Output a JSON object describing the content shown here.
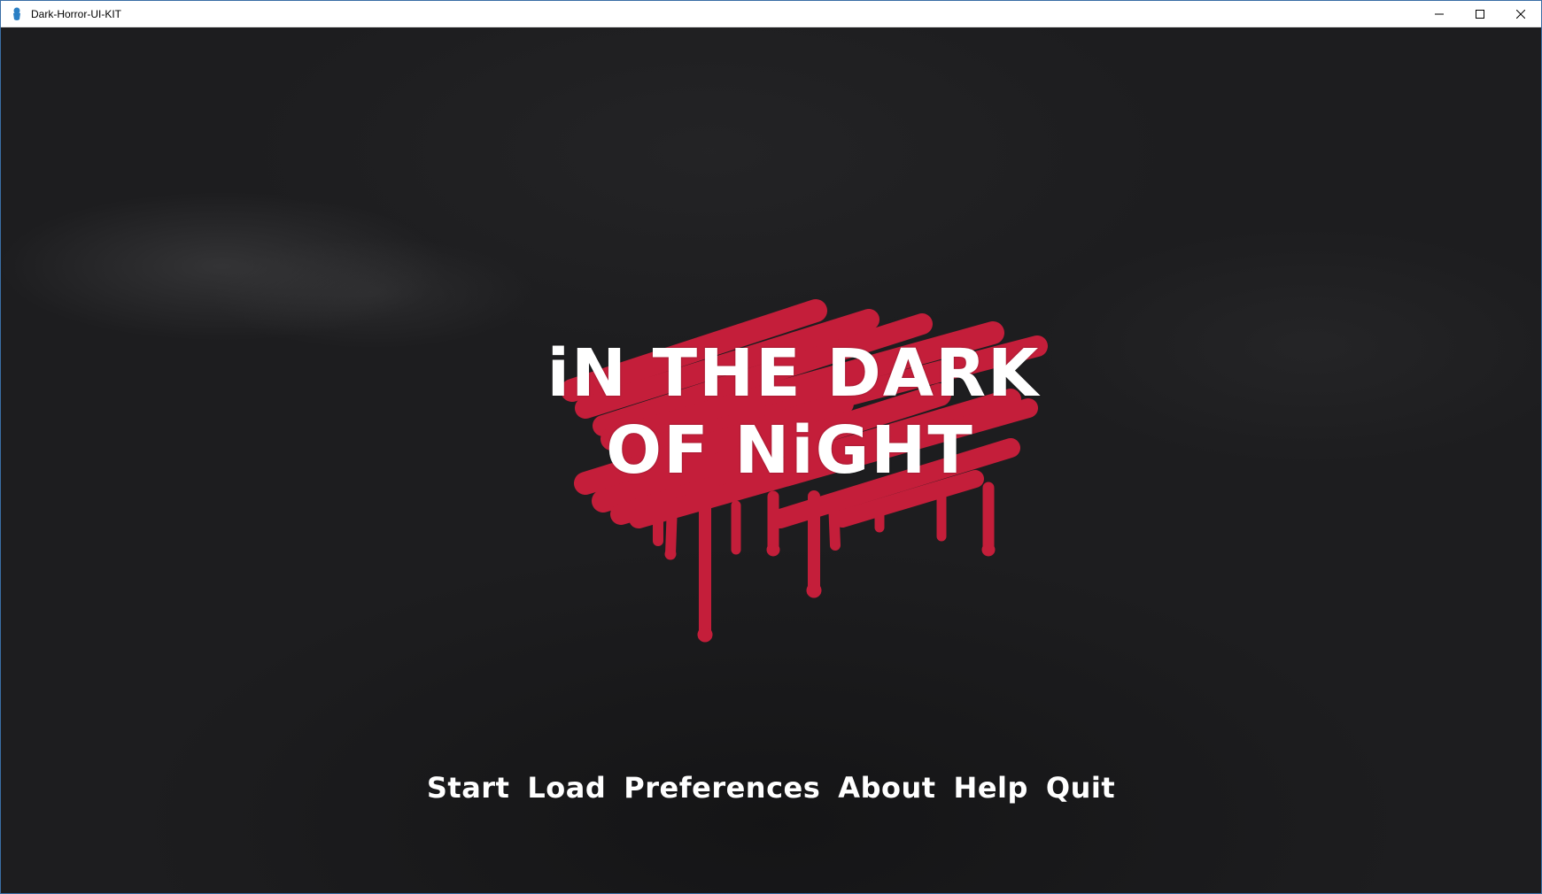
{
  "window": {
    "title": "Dark-Horror-UI-KIT",
    "app_icon": "renpy-icon",
    "controls": [
      "minimize-icon",
      "maximize-icon",
      "close-icon"
    ]
  },
  "logo": {
    "line1": "iN THE DARK",
    "line2": "OF NiGHT",
    "accent_color": "#c41e3a",
    "text_color": "#ffffff"
  },
  "main_menu": {
    "items": [
      "Start",
      "Load",
      "Preferences",
      "About",
      "Help",
      "Quit"
    ]
  },
  "colors": {
    "background": "#1d1d1f",
    "blood": "#c41e3a"
  }
}
